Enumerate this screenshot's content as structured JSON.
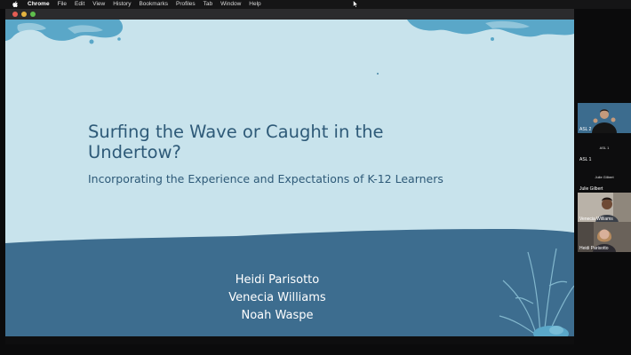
{
  "menubar": {
    "items": [
      "Chrome",
      "File",
      "Edit",
      "View",
      "History",
      "Bookmarks",
      "Profiles",
      "Tab",
      "Window",
      "Help"
    ]
  },
  "slide": {
    "title": "Surfing the Wave or Caught in the Undertow?",
    "subtitle": "Incorporating the Experience and Expectations of K-12 Learners",
    "presenters": [
      "Heidi Parisotto",
      "Venecia Williams",
      "Noah Waspe"
    ]
  },
  "participants": [
    {
      "label": "ASL 2"
    },
    {
      "label": "ASL 1",
      "top_text": "ASL 1"
    },
    {
      "label": "Julie Gilbert",
      "top_text": "Julie Gilbert"
    },
    {
      "label": "Venecia Williams"
    },
    {
      "label": "Heidi Parisotto"
    }
  ],
  "colors": {
    "slide_bg": "#c8e3ec",
    "wave": "#3d6d8f",
    "title_text": "#2e5a78",
    "accent_blue": "#5aa7c8"
  }
}
